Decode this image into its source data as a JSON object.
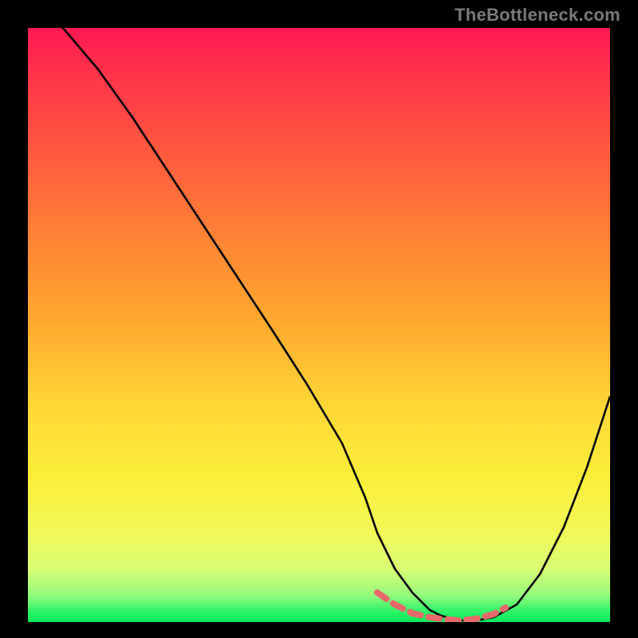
{
  "watermark": "TheBottleneck.com",
  "chart_data": {
    "type": "line",
    "title": "",
    "xlabel": "",
    "ylabel": "",
    "xlim": [
      0,
      100
    ],
    "ylim": [
      0,
      100
    ],
    "series": [
      {
        "name": "curve",
        "x": [
          0,
          6,
          12,
          18,
          24,
          30,
          36,
          42,
          48,
          54,
          58,
          60,
          63,
          66,
          69,
          71,
          74,
          77,
          80,
          84,
          88,
          92,
          96,
          100
        ],
        "values": [
          103,
          100,
          93,
          85,
          76,
          67,
          58,
          49,
          40,
          30,
          21,
          15,
          9,
          5,
          2,
          1,
          0.3,
          0.3,
          0.8,
          3,
          8,
          16,
          26,
          38
        ]
      },
      {
        "name": "highlight-band",
        "x": [
          60,
          63,
          66,
          69,
          71,
          74,
          77,
          80,
          82
        ],
        "values": [
          5,
          3,
          1.5,
          0.8,
          0.5,
          0.3,
          0.5,
          1.3,
          2.5
        ]
      }
    ],
    "gradient_stops": [
      {
        "pos": 0,
        "color": "#ff1a52"
      },
      {
        "pos": 22,
        "color": "#ff5c3e"
      },
      {
        "pos": 50,
        "color": "#ffab2f"
      },
      {
        "pos": 76,
        "color": "#fbef3b"
      },
      {
        "pos": 91,
        "color": "#d9fd75"
      },
      {
        "pos": 100,
        "color": "#06eb5b"
      }
    ]
  }
}
